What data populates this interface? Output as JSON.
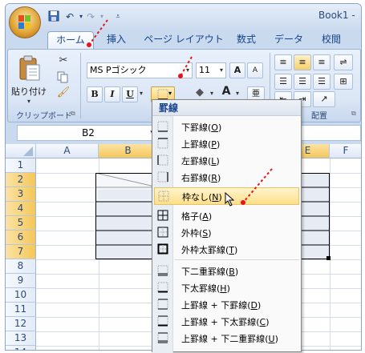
{
  "window": {
    "title": "Book1 -"
  },
  "tabs": [
    "ホーム",
    "挿入",
    "ページ レイアウト",
    "数式",
    "データ",
    "校閲"
  ],
  "ribbon": {
    "clipboard": {
      "paste_label": "貼り付け",
      "group_label": "クリップボード"
    },
    "font": {
      "font_name": "MS Pゴシック",
      "font_size": "11",
      "bold": "B",
      "italic": "I",
      "underline": "U",
      "grow": "A",
      "shrink": "A"
    },
    "alignment": {
      "group_label": "配置"
    }
  },
  "formula_bar": {
    "name_box": "B2"
  },
  "sheet": {
    "columns": [
      "A",
      "B",
      "C",
      "D",
      "E",
      "F"
    ],
    "selected_column": "B",
    "rows": [
      "1",
      "2",
      "3",
      "4",
      "5",
      "6",
      "7",
      "8",
      "9",
      "10",
      "11",
      "12",
      "13",
      "14"
    ],
    "selected_rows": [
      "2",
      "3",
      "4",
      "5",
      "6",
      "7"
    ]
  },
  "border_menu": {
    "title": "罫線",
    "items": [
      {
        "label": "下罫線(",
        "key": "O",
        "end": ")",
        "icon": "bottom-border-icon"
      },
      {
        "label": "上罫線(",
        "key": "P",
        "end": ")",
        "icon": "top-border-icon"
      },
      {
        "label": "左罫線(",
        "key": "L",
        "end": ")",
        "icon": "left-border-icon"
      },
      {
        "label": "右罫線(",
        "key": "R",
        "end": ")",
        "icon": "right-border-icon"
      },
      {
        "label": "枠なし(",
        "key": "N",
        "end": ")",
        "icon": "no-border-icon",
        "highlighted": true
      },
      {
        "label": "格子(",
        "key": "A",
        "end": ")",
        "icon": "all-borders-icon"
      },
      {
        "label": "外枠(",
        "key": "S",
        "end": ")",
        "icon": "outside-border-icon"
      },
      {
        "label": "外枠太罫線(",
        "key": "T",
        "end": ")",
        "icon": "thick-box-border-icon"
      },
      {
        "label": "下二重罫線(",
        "key": "B",
        "end": ")",
        "icon": "bottom-double-border-icon"
      },
      {
        "label": "下太罫線(",
        "key": "H",
        "end": ")",
        "icon": "thick-bottom-border-icon"
      },
      {
        "label": "上罫線 + 下罫線(",
        "key": "D",
        "end": ")",
        "icon": "top-bottom-border-icon"
      },
      {
        "label": "上罫線 + 下太罫線(",
        "key": "C",
        "end": ")",
        "icon": "top-thick-bottom-border-icon"
      },
      {
        "label": "上罫線 + 下二重罫線(",
        "key": "U",
        "end": ")",
        "icon": "top-double-bottom-border-icon"
      }
    ]
  },
  "colors": {
    "highlight": "#fcdf8a",
    "selection_header": "#f5c75a",
    "annotation": "#e8141c"
  }
}
